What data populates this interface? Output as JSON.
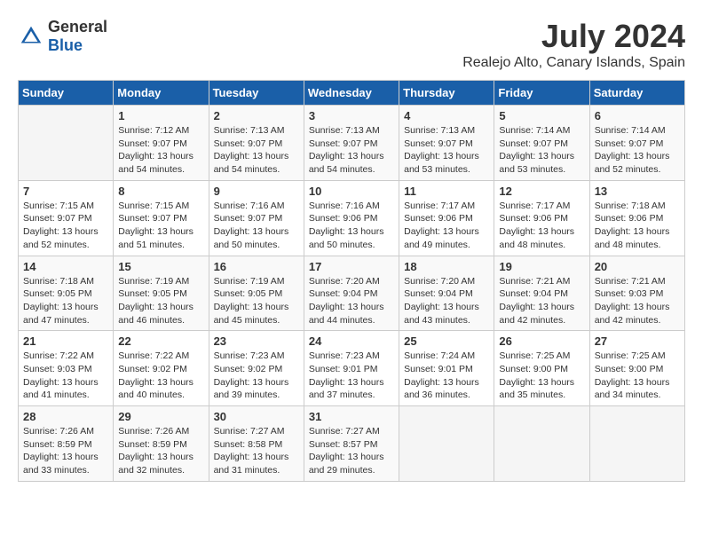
{
  "header": {
    "logo_general": "General",
    "logo_blue": "Blue",
    "month_year": "July 2024",
    "location": "Realejo Alto, Canary Islands, Spain"
  },
  "weekdays": [
    "Sunday",
    "Monday",
    "Tuesday",
    "Wednesday",
    "Thursday",
    "Friday",
    "Saturday"
  ],
  "weeks": [
    [
      {
        "day": null,
        "sunrise": null,
        "sunset": null,
        "daylight": null
      },
      {
        "day": "1",
        "sunrise": "Sunrise: 7:12 AM",
        "sunset": "Sunset: 9:07 PM",
        "daylight": "Daylight: 13 hours and 54 minutes."
      },
      {
        "day": "2",
        "sunrise": "Sunrise: 7:13 AM",
        "sunset": "Sunset: 9:07 PM",
        "daylight": "Daylight: 13 hours and 54 minutes."
      },
      {
        "day": "3",
        "sunrise": "Sunrise: 7:13 AM",
        "sunset": "Sunset: 9:07 PM",
        "daylight": "Daylight: 13 hours and 54 minutes."
      },
      {
        "day": "4",
        "sunrise": "Sunrise: 7:13 AM",
        "sunset": "Sunset: 9:07 PM",
        "daylight": "Daylight: 13 hours and 53 minutes."
      },
      {
        "day": "5",
        "sunrise": "Sunrise: 7:14 AM",
        "sunset": "Sunset: 9:07 PM",
        "daylight": "Daylight: 13 hours and 53 minutes."
      },
      {
        "day": "6",
        "sunrise": "Sunrise: 7:14 AM",
        "sunset": "Sunset: 9:07 PM",
        "daylight": "Daylight: 13 hours and 52 minutes."
      }
    ],
    [
      {
        "day": "7",
        "sunrise": "Sunrise: 7:15 AM",
        "sunset": "Sunset: 9:07 PM",
        "daylight": "Daylight: 13 hours and 52 minutes."
      },
      {
        "day": "8",
        "sunrise": "Sunrise: 7:15 AM",
        "sunset": "Sunset: 9:07 PM",
        "daylight": "Daylight: 13 hours and 51 minutes."
      },
      {
        "day": "9",
        "sunrise": "Sunrise: 7:16 AM",
        "sunset": "Sunset: 9:07 PM",
        "daylight": "Daylight: 13 hours and 50 minutes."
      },
      {
        "day": "10",
        "sunrise": "Sunrise: 7:16 AM",
        "sunset": "Sunset: 9:06 PM",
        "daylight": "Daylight: 13 hours and 50 minutes."
      },
      {
        "day": "11",
        "sunrise": "Sunrise: 7:17 AM",
        "sunset": "Sunset: 9:06 PM",
        "daylight": "Daylight: 13 hours and 49 minutes."
      },
      {
        "day": "12",
        "sunrise": "Sunrise: 7:17 AM",
        "sunset": "Sunset: 9:06 PM",
        "daylight": "Daylight: 13 hours and 48 minutes."
      },
      {
        "day": "13",
        "sunrise": "Sunrise: 7:18 AM",
        "sunset": "Sunset: 9:06 PM",
        "daylight": "Daylight: 13 hours and 48 minutes."
      }
    ],
    [
      {
        "day": "14",
        "sunrise": "Sunrise: 7:18 AM",
        "sunset": "Sunset: 9:05 PM",
        "daylight": "Daylight: 13 hours and 47 minutes."
      },
      {
        "day": "15",
        "sunrise": "Sunrise: 7:19 AM",
        "sunset": "Sunset: 9:05 PM",
        "daylight": "Daylight: 13 hours and 46 minutes."
      },
      {
        "day": "16",
        "sunrise": "Sunrise: 7:19 AM",
        "sunset": "Sunset: 9:05 PM",
        "daylight": "Daylight: 13 hours and 45 minutes."
      },
      {
        "day": "17",
        "sunrise": "Sunrise: 7:20 AM",
        "sunset": "Sunset: 9:04 PM",
        "daylight": "Daylight: 13 hours and 44 minutes."
      },
      {
        "day": "18",
        "sunrise": "Sunrise: 7:20 AM",
        "sunset": "Sunset: 9:04 PM",
        "daylight": "Daylight: 13 hours and 43 minutes."
      },
      {
        "day": "19",
        "sunrise": "Sunrise: 7:21 AM",
        "sunset": "Sunset: 9:04 PM",
        "daylight": "Daylight: 13 hours and 42 minutes."
      },
      {
        "day": "20",
        "sunrise": "Sunrise: 7:21 AM",
        "sunset": "Sunset: 9:03 PM",
        "daylight": "Daylight: 13 hours and 42 minutes."
      }
    ],
    [
      {
        "day": "21",
        "sunrise": "Sunrise: 7:22 AM",
        "sunset": "Sunset: 9:03 PM",
        "daylight": "Daylight: 13 hours and 41 minutes."
      },
      {
        "day": "22",
        "sunrise": "Sunrise: 7:22 AM",
        "sunset": "Sunset: 9:02 PM",
        "daylight": "Daylight: 13 hours and 40 minutes."
      },
      {
        "day": "23",
        "sunrise": "Sunrise: 7:23 AM",
        "sunset": "Sunset: 9:02 PM",
        "daylight": "Daylight: 13 hours and 39 minutes."
      },
      {
        "day": "24",
        "sunrise": "Sunrise: 7:23 AM",
        "sunset": "Sunset: 9:01 PM",
        "daylight": "Daylight: 13 hours and 37 minutes."
      },
      {
        "day": "25",
        "sunrise": "Sunrise: 7:24 AM",
        "sunset": "Sunset: 9:01 PM",
        "daylight": "Daylight: 13 hours and 36 minutes."
      },
      {
        "day": "26",
        "sunrise": "Sunrise: 7:25 AM",
        "sunset": "Sunset: 9:00 PM",
        "daylight": "Daylight: 13 hours and 35 minutes."
      },
      {
        "day": "27",
        "sunrise": "Sunrise: 7:25 AM",
        "sunset": "Sunset: 9:00 PM",
        "daylight": "Daylight: 13 hours and 34 minutes."
      }
    ],
    [
      {
        "day": "28",
        "sunrise": "Sunrise: 7:26 AM",
        "sunset": "Sunset: 8:59 PM",
        "daylight": "Daylight: 13 hours and 33 minutes."
      },
      {
        "day": "29",
        "sunrise": "Sunrise: 7:26 AM",
        "sunset": "Sunset: 8:59 PM",
        "daylight": "Daylight: 13 hours and 32 minutes."
      },
      {
        "day": "30",
        "sunrise": "Sunrise: 7:27 AM",
        "sunset": "Sunset: 8:58 PM",
        "daylight": "Daylight: 13 hours and 31 minutes."
      },
      {
        "day": "31",
        "sunrise": "Sunrise: 7:27 AM",
        "sunset": "Sunset: 8:57 PM",
        "daylight": "Daylight: 13 hours and 29 minutes."
      },
      {
        "day": null,
        "sunrise": null,
        "sunset": null,
        "daylight": null
      },
      {
        "day": null,
        "sunrise": null,
        "sunset": null,
        "daylight": null
      },
      {
        "day": null,
        "sunrise": null,
        "sunset": null,
        "daylight": null
      }
    ]
  ]
}
